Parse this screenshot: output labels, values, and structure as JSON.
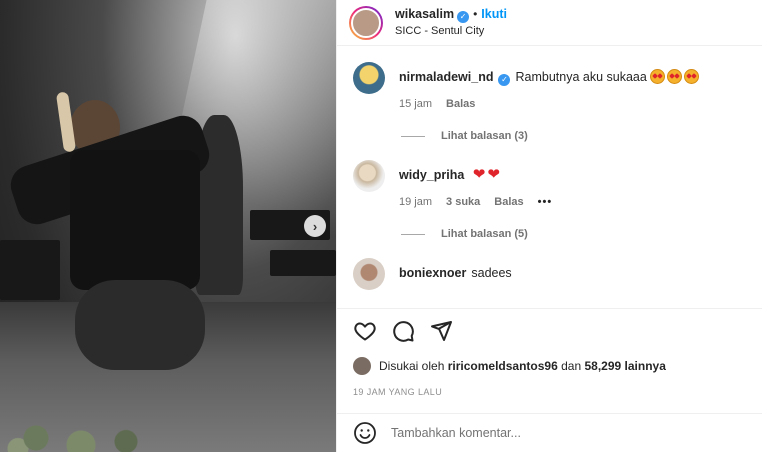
{
  "header": {
    "username": "wikasalim",
    "separator": "•",
    "follow_label": "Ikuti",
    "location": "SICC - Sentul City"
  },
  "comments": [
    {
      "user": "nirmaladewi_nd",
      "verified": true,
      "text": "Rambutnya aku sukaaa",
      "emoji": "star-struck-emoji x3",
      "time": "15 jam",
      "reply_label": "Balas",
      "view_replies": "Lihat balasan (3)"
    },
    {
      "user": "widy_priha",
      "text": "",
      "emoji": "red-heart-emoji x2",
      "time": "19 jam",
      "likes": "3 suka",
      "reply_label": "Balas",
      "more": "•••",
      "view_replies": "Lihat balasan (5)"
    },
    {
      "user": "boniexnoer",
      "text": "sadees"
    }
  ],
  "likes": {
    "prefix": "Disukai oleh",
    "user": "riricomeldsantos96",
    "joiner": "dan",
    "count": "58,299 lainnya"
  },
  "timestamp": "19 JAM YANG LALU",
  "add_comment": {
    "placeholder": "Tambahkan komentar..."
  },
  "colors": {
    "accent": "#0095f6",
    "verified": "#3897f0",
    "heart": "#e0242b"
  }
}
